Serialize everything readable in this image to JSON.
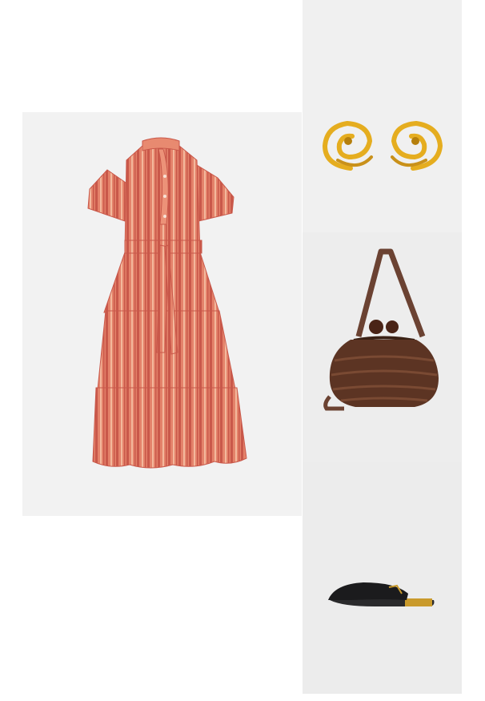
{
  "outfit": {
    "items": [
      {
        "id": "dress",
        "icon": "striped-tiered-dress",
        "colors": {
          "base": "#e4826a",
          "stripe": "#c9584a",
          "stripe_light": "#f3b89c"
        }
      },
      {
        "id": "earrings",
        "icon": "gold-swirl-earrings",
        "colors": {
          "gold": "#e5ad1f",
          "gold_dark": "#b57f0c"
        }
      },
      {
        "id": "bag",
        "icon": "woven-brown-handbag",
        "colors": {
          "leather": "#5c3423",
          "strap": "#6b4232",
          "knob": "#4a2417"
        }
      },
      {
        "id": "shoes",
        "icon": "black-slide-sandal",
        "colors": {
          "leather": "#1b1b1d",
          "gold": "#c99a2c"
        }
      }
    ],
    "background_colors": {
      "dress_panel": "#f2f2f2",
      "right_column": "#f0f0f0"
    }
  }
}
